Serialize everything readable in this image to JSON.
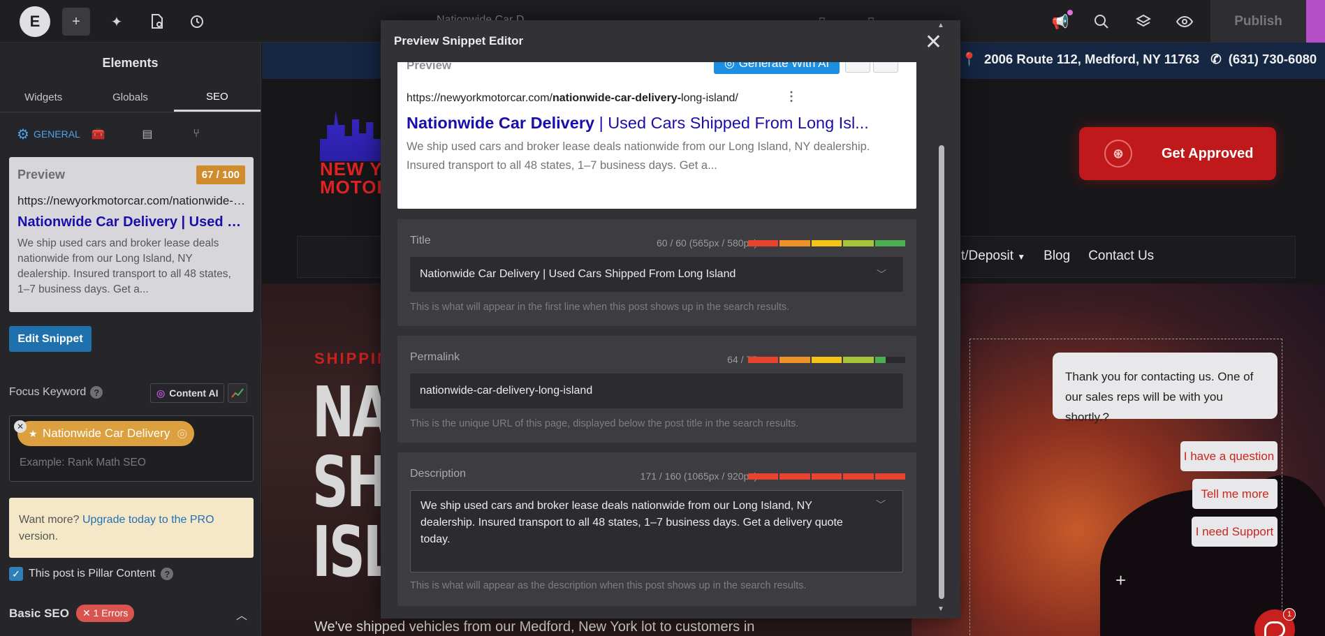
{
  "topbar": {
    "logo_icon": "elementor-logo-icon",
    "doc_title": "Nationwide Car D...",
    "publish_label": "Publish"
  },
  "panel": {
    "title": "Elements",
    "tabs": [
      "Widgets",
      "Globals",
      "SEO"
    ],
    "subtabs": {
      "general": "GENERAL"
    },
    "preview": {
      "label": "Preview",
      "score": "67 / 100",
      "url": "https://newyorkmotorcar.com/nationwide-car-delivery-long-island/",
      "title": "Nationwide Car Delivery | Used Cars Shipped From Long Island",
      "description": "We ship used cars and broker lease deals nationwide from our Long Island, NY dealership. Insured transport to all 48 states, 1–7 business days. Get a..."
    },
    "edit_snippet": "Edit Snippet",
    "focus_keyword_label": "Focus Keyword",
    "content_ai": "Content AI",
    "keyword": "Nationwide Car Delivery",
    "keyword_placeholder": "Example: Rank Math SEO",
    "upgrade_prefix": "Want more?",
    "upgrade_link": "Upgrade today to the PRO",
    "upgrade_suffix": "version.",
    "pillar_label": "This post is Pillar Content",
    "basic_seo": "Basic SEO",
    "errors_badge": "1 Errors"
  },
  "site": {
    "address": "2006 Route 112, Medford, NY 11763",
    "phone": "(631) 730-6080",
    "logo_text_1": "NEW Y",
    "logo_text_2": "MOTOR",
    "get_approved": "Get Approved",
    "nav": [
      "t/Deposit",
      "Blog",
      "Contact Us"
    ],
    "shipping": "SHIPPIN",
    "hero_lines": [
      "NAT",
      "SHI",
      "ISL"
    ],
    "hero_sub": "We've shipped vehicles from our Medford, New York lot to customers in",
    "chat": {
      "message": "Thank you for contacting us. One of our sales reps will be with you shortly.?",
      "options": [
        "I have a question",
        "Tell me more",
        "I need Support"
      ],
      "count": "1"
    }
  },
  "modal": {
    "title": "Preview Snippet Editor",
    "preview_label": "Preview",
    "generate_ai": "Generate With AI",
    "url_prefix": "https://newyorkmotorcar.com/",
    "url_bold": "nationwide-car-delivery-",
    "url_suffix": "long-island/",
    "serp_title_bold": "Nationwide Car Delivery",
    "serp_title_rest": " | Used Cars Shipped From Long Isl...",
    "serp_desc": "We ship used cars and broker lease deals nationwide from our Long Island, NY dealership. Insured transport to all 48 states, 1–7 business days. Get a...",
    "title_field": {
      "label": "Title",
      "count": "60 / 60 (565px / 580px)",
      "value": "Nationwide Car Delivery | Used Cars Shipped From Long Island",
      "help": "This is what will appear in the first line when this post shows up in the search results.",
      "progress": 1.0
    },
    "permalink_field": {
      "label": "Permalink",
      "count": "64 / 75",
      "value": "nationwide-car-delivery-long-island",
      "help": "This is the unique URL of this page, displayed below the post title in the search results.",
      "progress": 0.85
    },
    "description_field": {
      "label": "Description",
      "count": "171 / 160 (1065px / 920px)",
      "value": "We ship used cars and broker lease deals nationwide from our Long Island, NY dealership. Insured transport to all 48 states, 1–7 business days. Get a delivery quote today.",
      "help": "This is what will appear as the description when this post shows up in the search results.",
      "progress": 1.0
    }
  },
  "colors": {
    "accent_blue": "#1f71ad",
    "score_orange": "#d08b2c",
    "keyword_tag": "#dca13e",
    "error_red": "#d9534f",
    "brand_red": "#c0191c",
    "publish_purple": "#b44fc8"
  }
}
